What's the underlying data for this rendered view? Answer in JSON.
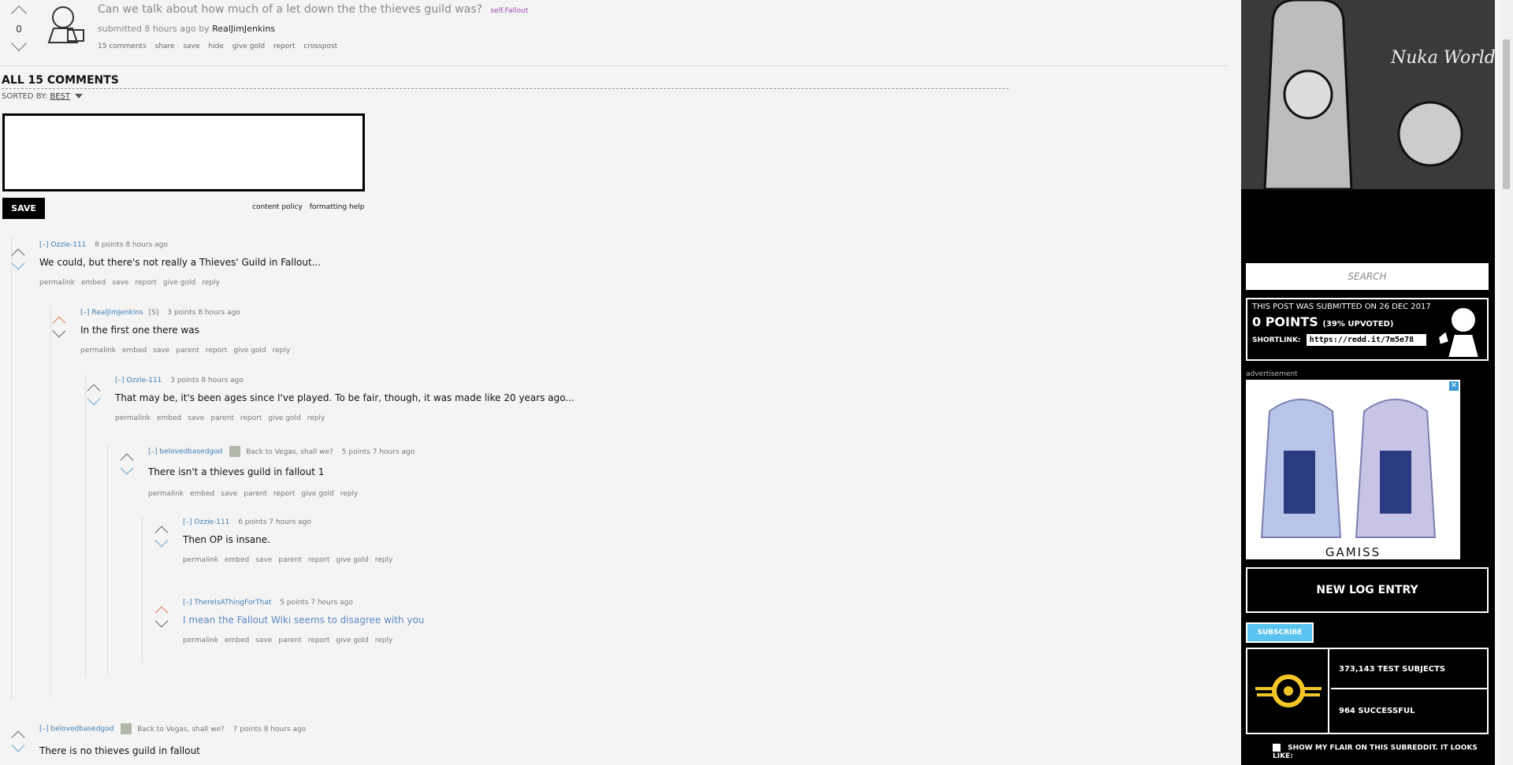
{
  "post": {
    "score": "0",
    "title": "Can we talk about how much of a let down the the thieves guild was?",
    "flair": "self.Fallout",
    "submitted": "submitted 8 hours ago by",
    "author": "RealJimJenkins",
    "buttons": [
      "15 comments",
      "share",
      "save",
      "hide",
      "give gold",
      "report",
      "crosspost"
    ]
  },
  "comments_header": "ALL 15 COMMENTS",
  "sort": {
    "label": "SORTED BY:",
    "value": "BEST"
  },
  "editor": {
    "save": "SAVE",
    "links": [
      "content policy",
      "formatting help"
    ]
  },
  "comments": [
    {
      "author": "Ozzie-111",
      "collapse": "[–]",
      "user_flair": "",
      "points": "8 points 8 hours ago",
      "body": "We could, but there's not really a Thieves' Guild in Fallout...",
      "buttons": [
        "permalink",
        "embed",
        "save",
        "report",
        "give gold",
        "reply"
      ]
    },
    {
      "author": "RealJimJenkins",
      "collapse": "[–]",
      "user_flair": "[S]",
      "points": "3 points 8 hours ago",
      "body": "In the first one there was",
      "buttons": [
        "permalink",
        "embed",
        "save",
        "parent",
        "report",
        "give gold",
        "reply"
      ]
    },
    {
      "author": "Ozzie-111",
      "collapse": "[–]",
      "user_flair": "",
      "points": "3 points 8 hours ago",
      "body": "That may be, it's been ages since I've played. To be fair, though, it was made like 20 years ago...",
      "buttons": [
        "permalink",
        "embed",
        "save",
        "parent",
        "report",
        "give gold",
        "reply"
      ]
    },
    {
      "author": "belovedbasedgod",
      "collapse": "[–]",
      "user_flair": "Back to Vegas, shall we?",
      "points": "5 points 7 hours ago",
      "body": "There isn't a thieves guild in fallout 1",
      "buttons": [
        "permalink",
        "embed",
        "save",
        "parent",
        "report",
        "give gold",
        "reply"
      ]
    },
    {
      "author": "Ozzie-111",
      "collapse": "[–]",
      "user_flair": "",
      "points": "6 points 7 hours ago",
      "body": "Then OP is insane.",
      "buttons": [
        "permalink",
        "embed",
        "save",
        "parent",
        "report",
        "give gold",
        "reply"
      ]
    },
    {
      "author": "ThereIsAThingForThat",
      "collapse": "[–]",
      "user_flair": "",
      "points": "5 points 7 hours ago",
      "body": "I mean the Fallout Wiki seems to disagree with you",
      "buttons": [
        "permalink",
        "embed",
        "save",
        "parent",
        "report",
        "give gold",
        "reply"
      ]
    },
    {
      "author": "belovedbasedgod",
      "collapse": "[–]",
      "user_flair": "Back to Vegas, shall we?",
      "points": "7 points 8 hours ago",
      "body": "There is no thieves guild in fallout",
      "buttons": []
    }
  ],
  "sidebar": {
    "search_placeholder": "SEARCH",
    "submitted_on": "THIS POST WAS SUBMITTED ON 26 DEC 2017",
    "points": "0 POINTS",
    "upvoted": "(39% UPVOTED)",
    "shortlink_label": "SHORTLINK:",
    "shortlink": "https://redd.it/7m5e78",
    "ad_label": "advertisement",
    "ad_brand": "GAMISS",
    "new_log": "NEW LOG ENTRY",
    "subscribe": "SUBSCRIBE",
    "subscribers": "373,143 TEST SUBJECTS",
    "online": "964 SUCCESSFUL",
    "flair_check": "SHOW MY FLAIR ON THIS SUBREDDIT. IT LOOKS LIKE:"
  }
}
